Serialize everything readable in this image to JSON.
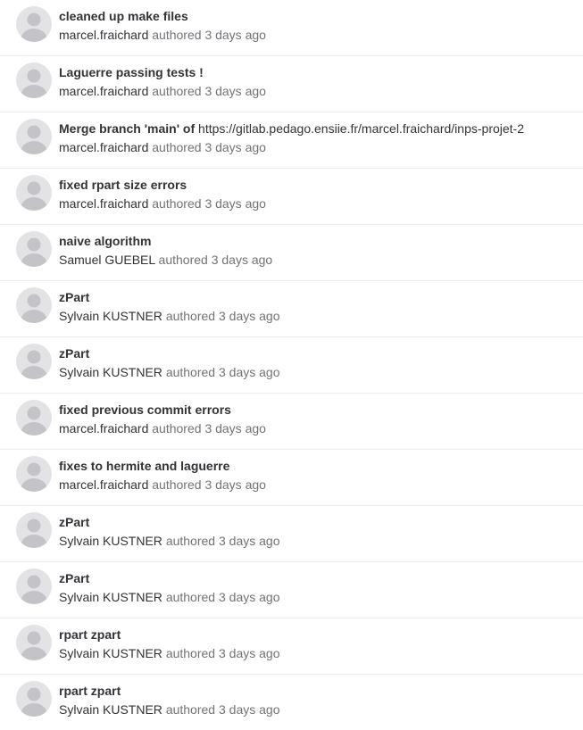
{
  "commits": [
    {
      "title": "cleaned up make files",
      "title_link": "",
      "author": "marcel.fraichard",
      "authored_label": "authored",
      "time_ago": "3 days ago"
    },
    {
      "title": "Laguerre passing tests !",
      "title_link": "",
      "author": "marcel.fraichard",
      "authored_label": "authored",
      "time_ago": "3 days ago"
    },
    {
      "title": "Merge branch 'main' of",
      "title_link": "https://gitlab.pedago.ensiie.fr/marcel.fraichard/inps-projet-2",
      "author": "marcel.fraichard",
      "authored_label": "authored",
      "time_ago": "3 days ago"
    },
    {
      "title": "fixed rpart size errors",
      "title_link": "",
      "author": "marcel.fraichard",
      "authored_label": "authored",
      "time_ago": "3 days ago"
    },
    {
      "title": "naive algorithm",
      "title_link": "",
      "author": "Samuel GUEBEL",
      "authored_label": "authored",
      "time_ago": "3 days ago"
    },
    {
      "title": "zPart",
      "title_link": "",
      "author": "Sylvain KUSTNER",
      "authored_label": "authored",
      "time_ago": "3 days ago"
    },
    {
      "title": "zPart",
      "title_link": "",
      "author": "Sylvain KUSTNER",
      "authored_label": "authored",
      "time_ago": "3 days ago"
    },
    {
      "title": "fixed previous commit errors",
      "title_link": "",
      "author": "marcel.fraichard",
      "authored_label": "authored",
      "time_ago": "3 days ago"
    },
    {
      "title": "fixes to hermite and laguerre",
      "title_link": "",
      "author": "marcel.fraichard",
      "authored_label": "authored",
      "time_ago": "3 days ago"
    },
    {
      "title": "zPart",
      "title_link": "",
      "author": "Sylvain KUSTNER",
      "authored_label": "authored",
      "time_ago": "3 days ago"
    },
    {
      "title": "zPart",
      "title_link": "",
      "author": "Sylvain KUSTNER",
      "authored_label": "authored",
      "time_ago": "3 days ago"
    },
    {
      "title": "rpart zpart",
      "title_link": "",
      "author": "Sylvain KUSTNER",
      "authored_label": "authored",
      "time_ago": "3 days ago"
    },
    {
      "title": "rpart zpart",
      "title_link": "",
      "author": "Sylvain KUSTNER",
      "authored_label": "authored",
      "time_ago": "3 days ago"
    }
  ],
  "icons": {
    "avatar": "default-user-avatar-icon"
  },
  "colors": {
    "title_text": "#333238",
    "meta_text": "#737278",
    "avatar_bg": "#e3e3e6",
    "avatar_fg": "#c4c4c8",
    "divider": "#ececef"
  }
}
